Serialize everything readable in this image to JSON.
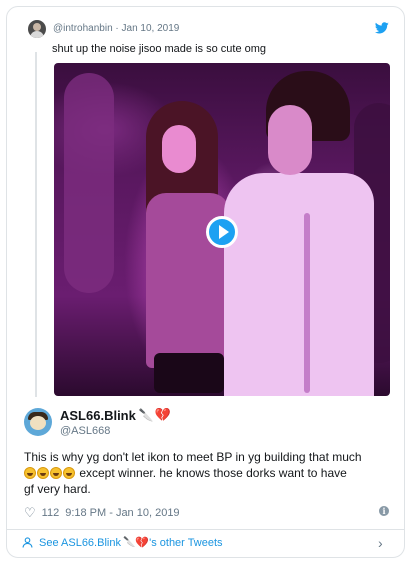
{
  "quoted_tweet": {
    "handle": "@introhanbin",
    "date": "Jan 10, 2019",
    "text": "shut up the noise jisoo made is so cute omg"
  },
  "main_tweet": {
    "display_name": "ASL66.Blink",
    "handle": "@ASL668",
    "text_line1": "This is why yg don't let ikon to meet BP in yg building that much",
    "text_line2_after_emojis": " except winner. he knows those dorks want to have",
    "text_line3": "gf very hard.",
    "likes": "112",
    "timestamp": "9:18 PM - Jan 10, 2019"
  },
  "footer": {
    "see_prefix": "See ASL66.Blink",
    "see_suffix": "'s other Tweets"
  },
  "icons": {
    "brand": "twitter-bird-icon",
    "play": "play-icon",
    "like": "heart-icon",
    "info": "info-icon",
    "profile": "person-icon",
    "chevron": "chevron-right-icon"
  },
  "colors": {
    "accent": "#1da1f2",
    "link": "#1b95e0",
    "secondary_text": "#657786",
    "border": "#dfe3e6"
  }
}
